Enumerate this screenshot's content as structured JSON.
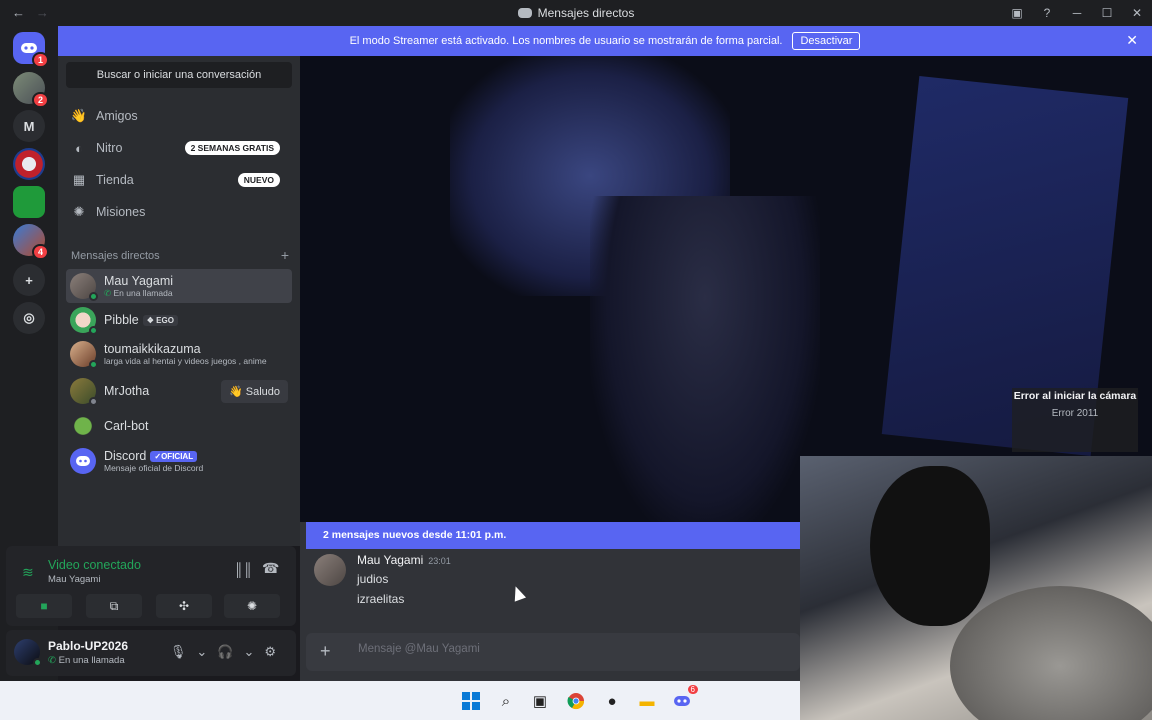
{
  "window": {
    "title": "Mensajes directos",
    "back": "←",
    "forward": "→"
  },
  "banner": {
    "text": "El modo Streamer está activado. Los nombres de usuario se mostrarán de forma parcial.",
    "button": "Desactivar",
    "close": "✕"
  },
  "guilds": {
    "home_badge": "1",
    "group_badge": "2",
    "m_label": "M",
    "minecraft_badge": "4"
  },
  "sidebar": {
    "search": "Buscar o iniciar una conversación",
    "nav": [
      {
        "label": "Amigos",
        "icon": "friends-icon"
      },
      {
        "label": "Nitro",
        "icon": "nitro-icon",
        "pill": "2 SEMANAS GRATIS"
      },
      {
        "label": "Tienda",
        "icon": "shop-icon",
        "pill": "NUEVO"
      },
      {
        "label": "Misiones",
        "icon": "quests-icon"
      }
    ],
    "dm_header": "Mensajes directos",
    "dms": [
      {
        "name": "Mau Yagami",
        "sub": "En una llamada"
      },
      {
        "name": "Pibble",
        "tag": "EGO"
      },
      {
        "name": "toumaikkikazuma",
        "sub": "larga vida al hentai y videos juegos , anime"
      },
      {
        "name": "MrJotha",
        "action": "Saludo"
      },
      {
        "name": "Carl-bot"
      },
      {
        "name": "Discord",
        "tag": "OFICIAL",
        "sub": "Mensaje oficial de Discord"
      }
    ]
  },
  "voice": {
    "title": "Video conectado",
    "sub": "Mau Yagami"
  },
  "user": {
    "name": "Pablo-UP2026",
    "status": "En una llamada"
  },
  "stage": {
    "error_title": "Error al iniciar la cámara",
    "error_code": "Error 2011"
  },
  "chat": {
    "new_messages": "2 mensajes nuevos desde 11:01 p.m.",
    "author": "Mau Yagami",
    "time": "23:01",
    "lines": [
      "judios",
      "izraelitas"
    ],
    "placeholder": "Mensaje @Mau Yagami"
  },
  "taskbar": {
    "discord_badge": "6"
  },
  "colors": {
    "accent": "#5865f2",
    "online": "#23a55a",
    "danger": "#f23f43",
    "sidebar": "#2b2d31",
    "chat": "#313338"
  }
}
